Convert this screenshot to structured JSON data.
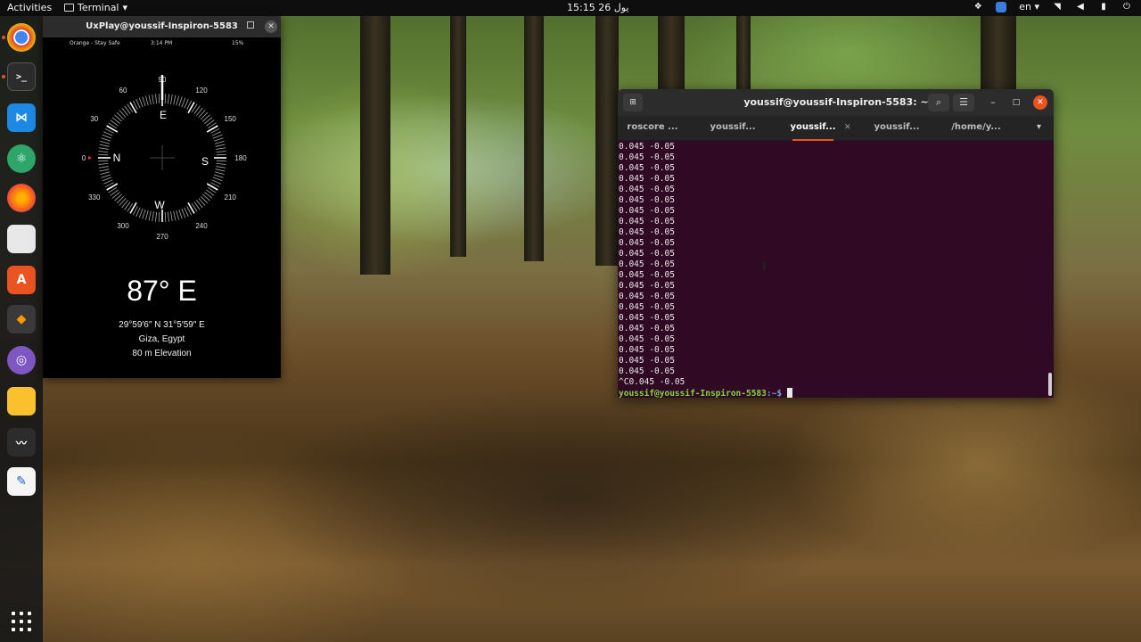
{
  "topbar": {
    "activities": "Activities",
    "app_name": "Terminal",
    "clock": "15:15  يول 26",
    "language": "en",
    "icons": [
      "dropbox-icon",
      "blue-app-icon",
      "wifi-icon",
      "volume-icon",
      "battery-icon",
      "power-icon"
    ]
  },
  "dock": {
    "apps": [
      "chrome-icon",
      "terminal-icon",
      "vscode-icon",
      "atom-icon",
      "firefox-icon",
      "files-icon",
      "software-icon",
      "sublime-icon",
      "screenshot-icon",
      "notes-icon",
      "system-monitor-icon",
      "text-editor-icon"
    ],
    "show_apps": "show-apps-icon"
  },
  "uxplay": {
    "title": "UxPlay@youssif-Inspiron-5583",
    "status_carrier": "Orange - Stay Safe",
    "status_time": "3:14 PM",
    "status_battery": "15%",
    "compass_degrees": [
      "90",
      "120",
      "150",
      "180",
      "210",
      "240",
      "270",
      "300",
      "330",
      "0",
      "30",
      "60"
    ],
    "compass_directions": {
      "north": "N",
      "east": "E",
      "south": "S",
      "west": "W"
    },
    "heading": "87° E",
    "coordinates": "29°59′6″ N  31°5′59″ E",
    "location": "Giza, Egypt",
    "elevation": "80 m Elevation"
  },
  "terminal": {
    "title": "youssif@youssif-Inspiron-5583: ~",
    "tabs": [
      "roscore ...",
      "youssif...",
      "youssif...",
      "youssif...",
      "/home/y..."
    ],
    "active_tab": 2,
    "output_line": "0.045 -0.05",
    "output_repeat": 22,
    "interrupt_line": "^C0.045 -0.05",
    "prompt_user": "youssif@youssif-Inspiron-5583",
    "prompt_path": ":~$"
  },
  "colors": {
    "terminal_bg": "#300a24",
    "accent": "#e95420",
    "prompt_green": "#87d441"
  }
}
